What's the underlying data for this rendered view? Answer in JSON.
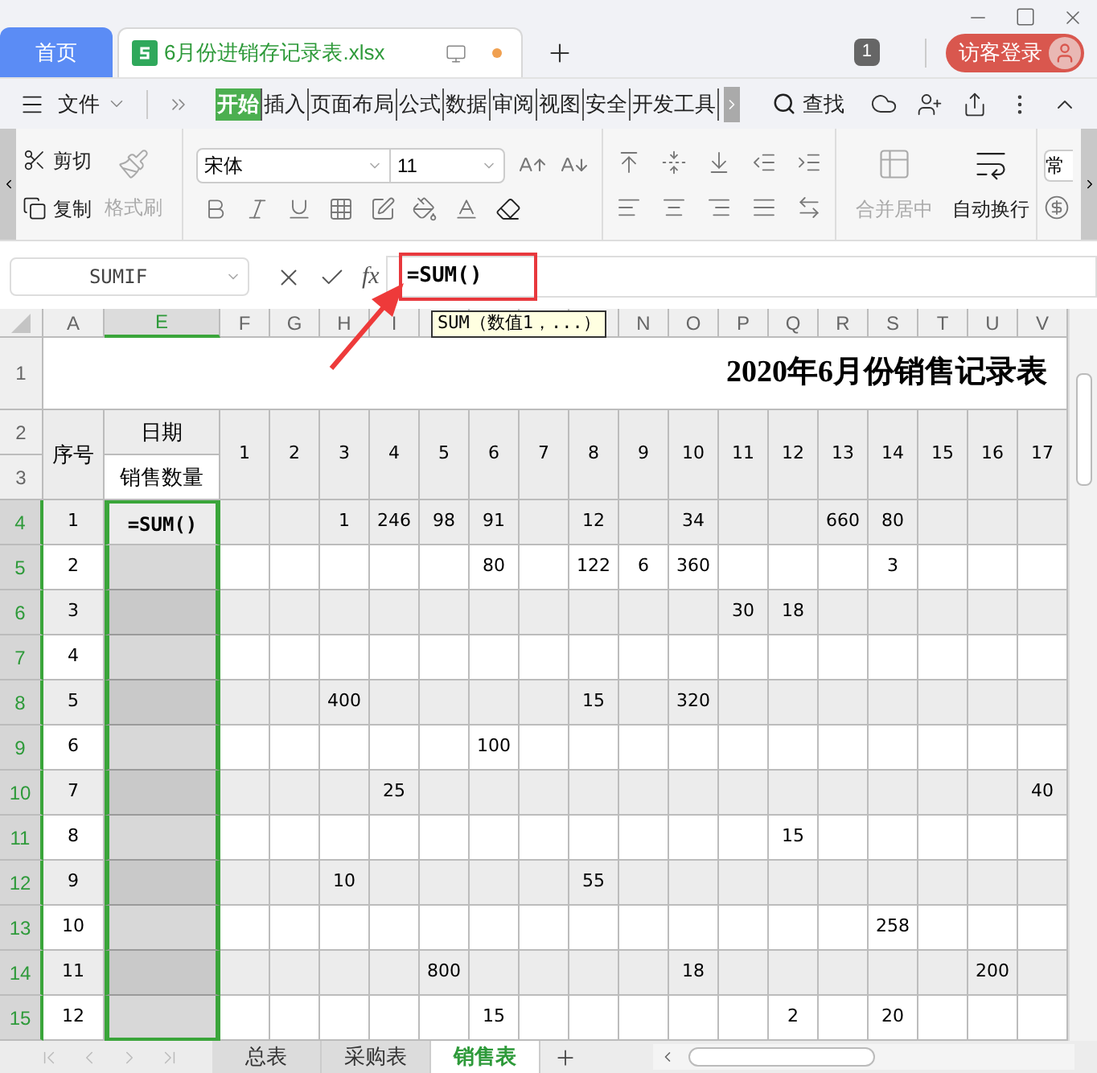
{
  "tabs": [
    {
      "label": "首页",
      "kind": "home",
      "selected": false
    },
    {
      "label": "6月份进销存记录表.xlsx",
      "kind": "document",
      "selected": true,
      "unsaved": true
    }
  ],
  "window_count": "1",
  "login_button": "访客登录",
  "menu": {
    "file": "文件",
    "search": "查找",
    "tabs": [
      {
        "label": "开始",
        "selected": true
      },
      {
        "label": "插入",
        "selected": false
      },
      {
        "label": "页面布局",
        "selected": false
      },
      {
        "label": "公式",
        "selected": false
      },
      {
        "label": "数据",
        "selected": false
      },
      {
        "label": "审阅",
        "selected": false
      },
      {
        "label": "视图",
        "selected": false
      },
      {
        "label": "安全",
        "selected": false
      },
      {
        "label": "开发工具",
        "selected": false
      }
    ]
  },
  "ribbon": {
    "cut": {
      "label": "剪切",
      "disabled": false
    },
    "copy": {
      "label": "复制",
      "disabled": false
    },
    "format_painter": {
      "label": "格式刷",
      "disabled": true
    },
    "font": "宋体",
    "font_size": "11",
    "merge": {
      "label": "合并居中",
      "disabled": true
    },
    "wrap": {
      "label": "自动换行",
      "disabled": false
    },
    "style": "常"
  },
  "formula_bar": {
    "name_box": "SUMIF",
    "fx": "fx",
    "formula": "=SUM()",
    "tooltip": "SUM（数值1，...）"
  },
  "sheet": {
    "col_a": {
      "letter": "A",
      "selected": false
    },
    "col_e": {
      "letter": "E",
      "selected": true
    },
    "columns": [
      {
        "letter": "F",
        "day": "1"
      },
      {
        "letter": "G",
        "day": "2"
      },
      {
        "letter": "H",
        "day": "3"
      },
      {
        "letter": "I",
        "day": "4"
      },
      {
        "day": "5"
      },
      {
        "day": "6"
      },
      {
        "day": "7"
      },
      {
        "day": "8"
      },
      {
        "letter": "N",
        "day": "9"
      },
      {
        "letter": "O",
        "day": "10"
      },
      {
        "letter": "P",
        "day": "11"
      },
      {
        "letter": "Q",
        "day": "12"
      },
      {
        "letter": "R",
        "day": "13"
      },
      {
        "letter": "S",
        "day": "14"
      },
      {
        "letter": "T",
        "day": "15"
      },
      {
        "letter": "U",
        "day": "16"
      },
      {
        "letter": "V",
        "day": "17"
      }
    ],
    "title_row": {
      "number": "1",
      "title": "2020年6月份销售记录表"
    },
    "header_rows": {
      "numbers": [
        "2",
        "3"
      ],
      "seq": "序号",
      "date": "日期",
      "quantity": "销售数量"
    },
    "rows": [
      {
        "number": "4",
        "seq": "1",
        "selected": true,
        "active": true,
        "formula": "=SUM()",
        "values": {
          "2": "1",
          "3": "246",
          "4": "98",
          "5": "91",
          "7": "12",
          "9": "34",
          "12": "660",
          "13": "80"
        }
      },
      {
        "number": "5",
        "seq": "2",
        "selected": true,
        "active": false,
        "values": {
          "5": "80",
          "7": "122",
          "8": "6",
          "9": "360",
          "13": "3"
        }
      },
      {
        "number": "6",
        "seq": "3",
        "selected": true,
        "active": false,
        "values": {
          "10": "30",
          "11": "18"
        }
      },
      {
        "number": "7",
        "seq": "4",
        "selected": true,
        "active": false
      },
      {
        "number": "8",
        "seq": "5",
        "selected": true,
        "active": false,
        "values": {
          "2": "400",
          "7": "15",
          "9": "320"
        }
      },
      {
        "number": "9",
        "seq": "6",
        "selected": true,
        "active": false,
        "values": {
          "5": "100"
        }
      },
      {
        "number": "10",
        "seq": "7",
        "selected": true,
        "active": false,
        "values": {
          "3": "25",
          "16": "40"
        }
      },
      {
        "number": "11",
        "seq": "8",
        "selected": true,
        "active": false,
        "values": {
          "11": "15"
        }
      },
      {
        "number": "12",
        "seq": "9",
        "selected": true,
        "active": false,
        "values": {
          "2": "10",
          "7": "55"
        }
      },
      {
        "number": "13",
        "seq": "10",
        "selected": true,
        "active": false,
        "values": {
          "13": "258"
        }
      },
      {
        "number": "14",
        "seq": "11",
        "selected": true,
        "active": false,
        "values": {
          "4": "800",
          "9": "18",
          "15": "200"
        }
      },
      {
        "number": "15",
        "seq": "12",
        "selected": true,
        "active": false,
        "values": {
          "5": "15",
          "11": "2",
          "13": "20"
        }
      }
    ]
  },
  "sheet_tabs": [
    {
      "label": "总表",
      "selected": false
    },
    {
      "label": "采购表",
      "selected": false
    },
    {
      "label": "销售表",
      "selected": true
    }
  ]
}
